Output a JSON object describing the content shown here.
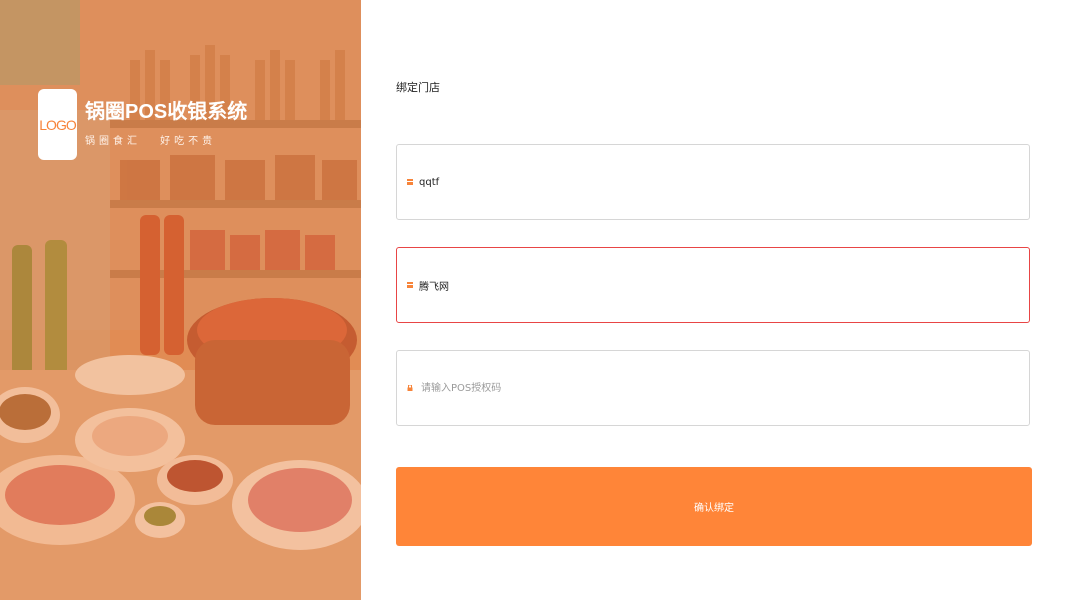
{
  "brand": {
    "logo_text": "LOGO",
    "title": "锅圈POS收银系统",
    "slogan": "锅圈食汇 好吃不贵"
  },
  "form": {
    "section_title": "绑定门店",
    "store_code": {
      "value": "qqtf",
      "icon": "store-icon"
    },
    "store_name": {
      "value": "腾飞网",
      "icon": "shop-icon"
    },
    "auth_code": {
      "placeholder": "请输入POS授权码",
      "icon": "lock-icon"
    },
    "confirm_label": "确认绑定"
  },
  "colors": {
    "accent": "#ff8538",
    "error_border": "#e84545"
  }
}
